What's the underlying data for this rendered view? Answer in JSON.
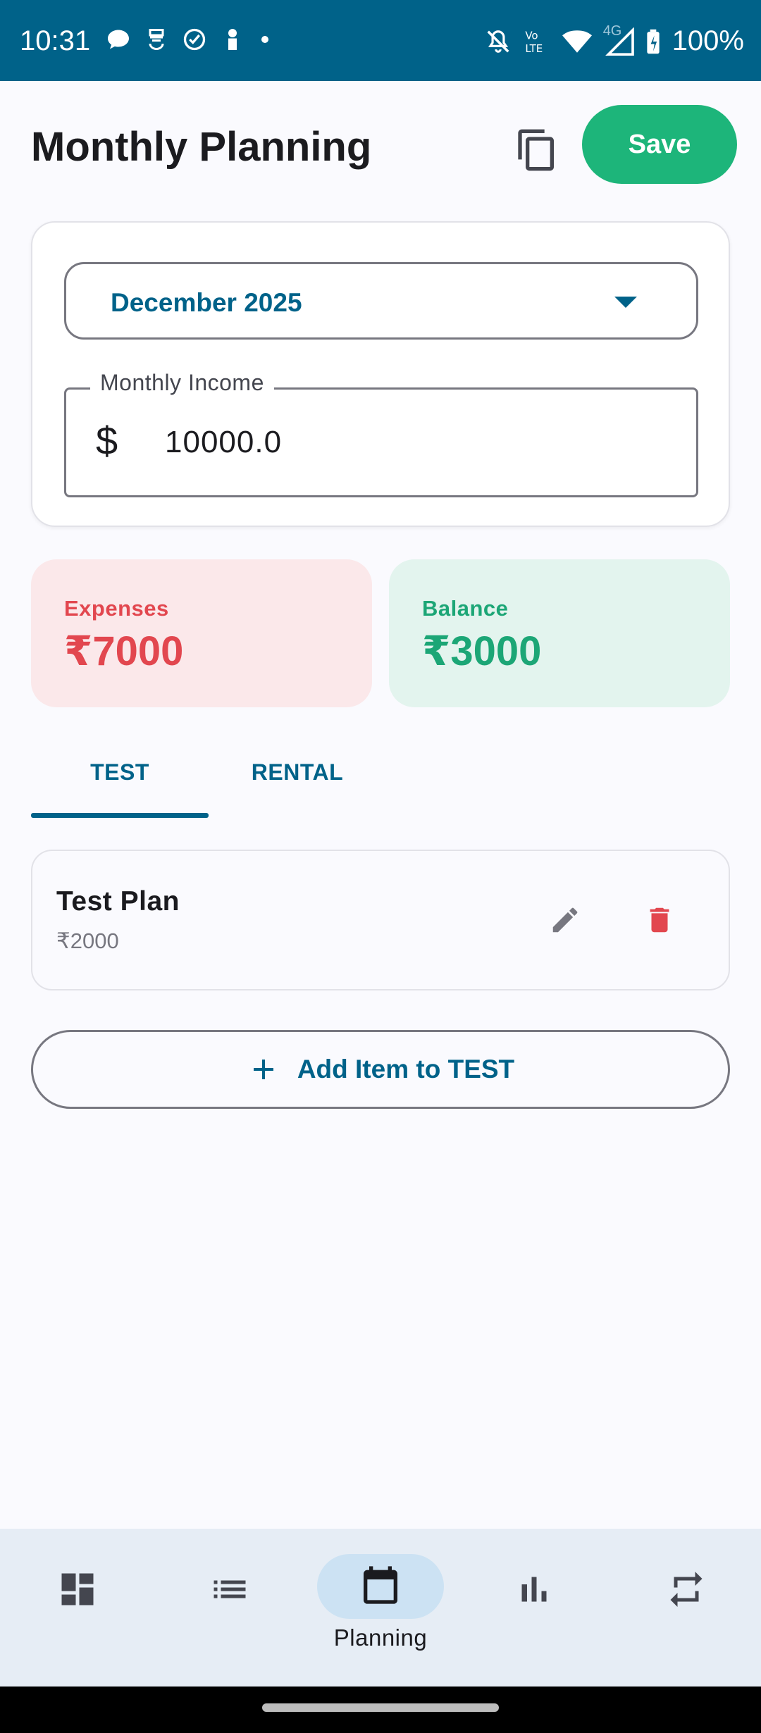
{
  "status_bar": {
    "time": "10:31",
    "battery": "100%",
    "network_type": "4G",
    "icons": [
      "chat-bubble-icon",
      "shield-icon",
      "check-circle-icon",
      "person-icon",
      "dot-icon",
      "mute-icon",
      "volte-icon",
      "wifi-icon",
      "signal-icon",
      "battery-charging-icon"
    ]
  },
  "header": {
    "title": "Monthly Planning",
    "save_label": "Save",
    "copy_icon": "copy-icon"
  },
  "period": {
    "selected_month": "December 2025"
  },
  "income": {
    "label": "Monthly Income",
    "currency_symbol": "$",
    "value": "10000.0"
  },
  "summary": {
    "expenses_label": "Expenses",
    "expenses_value": "₹7000",
    "balance_label": "Balance",
    "balance_value": "₹3000"
  },
  "tabs": [
    {
      "label": "TEST",
      "selected": true
    },
    {
      "label": "RENTAL",
      "selected": false
    }
  ],
  "items": [
    {
      "name": "Test Plan",
      "amount": "₹2000"
    }
  ],
  "add_button_label": "Add Item to TEST",
  "bottom_nav": {
    "items": [
      {
        "icon": "dashboard-icon",
        "label": ""
      },
      {
        "icon": "list-icon",
        "label": ""
      },
      {
        "icon": "calendar-icon",
        "label": "Planning",
        "selected": true
      },
      {
        "icon": "bar-chart-icon",
        "label": ""
      },
      {
        "icon": "repeat-icon",
        "label": ""
      }
    ]
  },
  "colors": {
    "primary": "#006289",
    "save_green": "#1db57a",
    "expense_red": "#e2474f",
    "balance_green": "#1ca676"
  }
}
